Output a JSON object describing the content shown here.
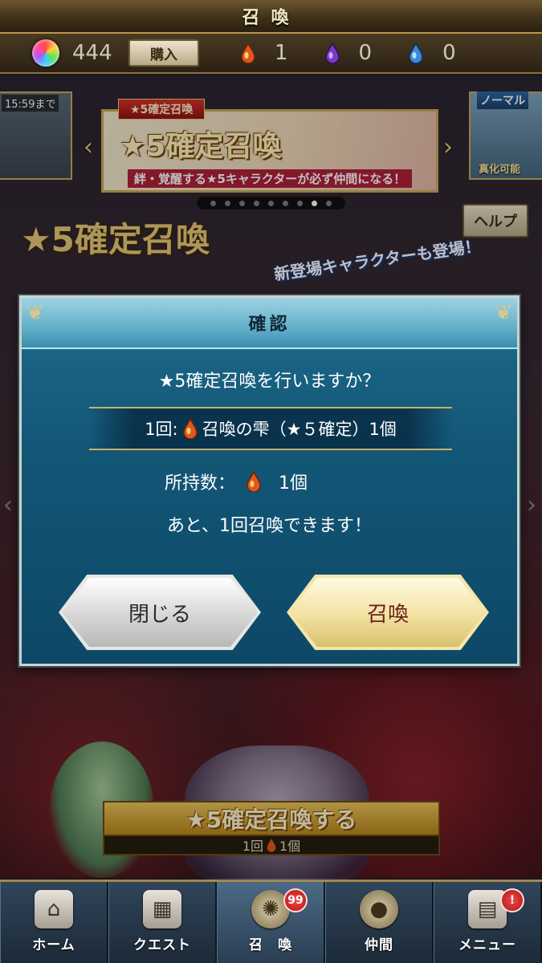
{
  "header": {
    "title": "召喚"
  },
  "currency": {
    "gems": "444",
    "buy_label": "購入",
    "red_drops": "1",
    "purple_drops": "0",
    "blue_drops": "0"
  },
  "banners": {
    "left_label": "15:59まで",
    "main_tag": "★5確定召喚",
    "main_title": "★5確定召喚",
    "main_sub": "絆・覚醒する★5キャラクターが必ず仲間になる！",
    "right_label": "ノーマル",
    "right_sub": "真化可能"
  },
  "pager": {
    "count": 9,
    "active_index": 7
  },
  "hero": {
    "title": "★5確定召喚",
    "caption": "新登場キャラクターも登場！"
  },
  "help_label": "ヘルプ",
  "modal": {
    "title": "確認",
    "question": "★5確定召喚を行いますか？",
    "cost_prefix": "1回:",
    "cost_text": "召喚の雫（★５確定）1個",
    "owned_label": "所持数：",
    "owned_count": "1個",
    "remaining": "あと、1回召喚できます！",
    "close_label": "閉じる",
    "summon_label": "召喚"
  },
  "summon_cta": {
    "label": "★5確定召喚する",
    "cost_prefix": "1回",
    "cost_suffix": "1個"
  },
  "nav": {
    "items": [
      {
        "label": "ホーム",
        "icon": "home-icon"
      },
      {
        "label": "クエスト",
        "icon": "map-icon"
      },
      {
        "label": "召　喚",
        "icon": "summon-icon",
        "badge": "99"
      },
      {
        "label": "仲間",
        "icon": "character-icon"
      },
      {
        "label": "メニュー",
        "icon": "scroll-icon",
        "badge": "!"
      }
    ]
  },
  "colors": {
    "accent_gold": "#c8a85a",
    "modal_blue": "#135777",
    "drop_red": "#e04a1a"
  }
}
